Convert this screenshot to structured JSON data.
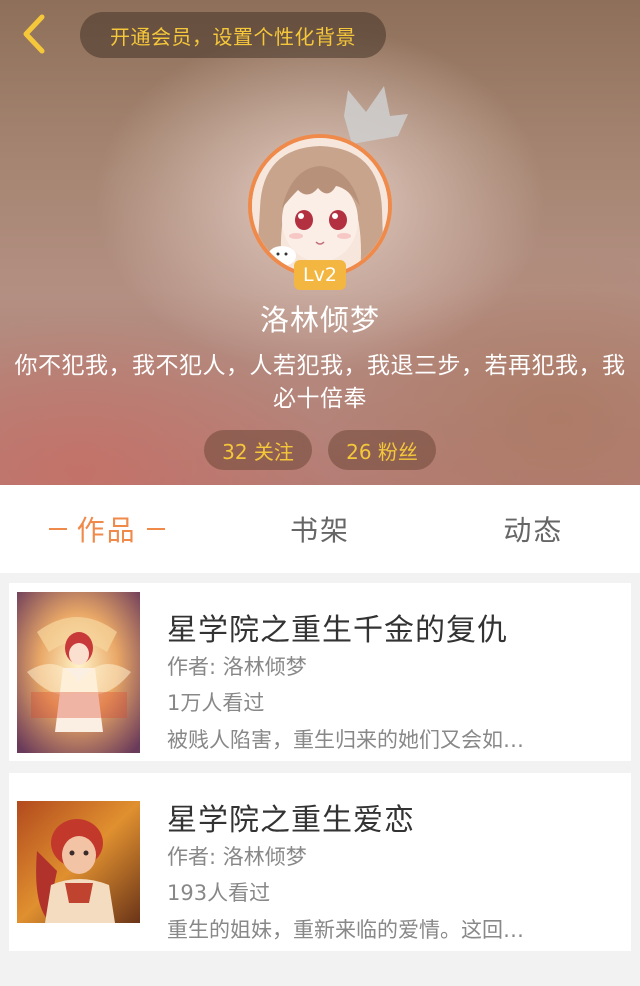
{
  "header": {
    "vip_prompt": "开通会员，设置个性化背景",
    "level_badge": "Lv2",
    "username": "洛林倾梦",
    "bio": "你不犯我，我不犯人，人若犯我，我退三步，若再犯我，我必十倍奉",
    "following": "32 关注",
    "fans": "26 粉丝",
    "icons": [
      "back-arrow-icon",
      "crown-icon"
    ]
  },
  "tabs": [
    {
      "label": "作品",
      "active": true
    },
    {
      "label": "书架",
      "active": false
    },
    {
      "label": "动态",
      "active": false
    }
  ],
  "books": [
    {
      "title": "星学院之重生千金的复仇",
      "author": "作者: 洛林倾梦",
      "views": "1万人看过",
      "description": "被贱人陷害，重生归来的她们又会如…"
    },
    {
      "title": "星学院之重生爱恋",
      "author": "作者: 洛林倾梦",
      "views": "193人看过",
      "description": "重生的姐妹，重新来临的爱情。这回…"
    }
  ],
  "colors": {
    "accent": "#f08a4a",
    "gold": "#f5c73a",
    "level_badge": "#f3b741"
  }
}
